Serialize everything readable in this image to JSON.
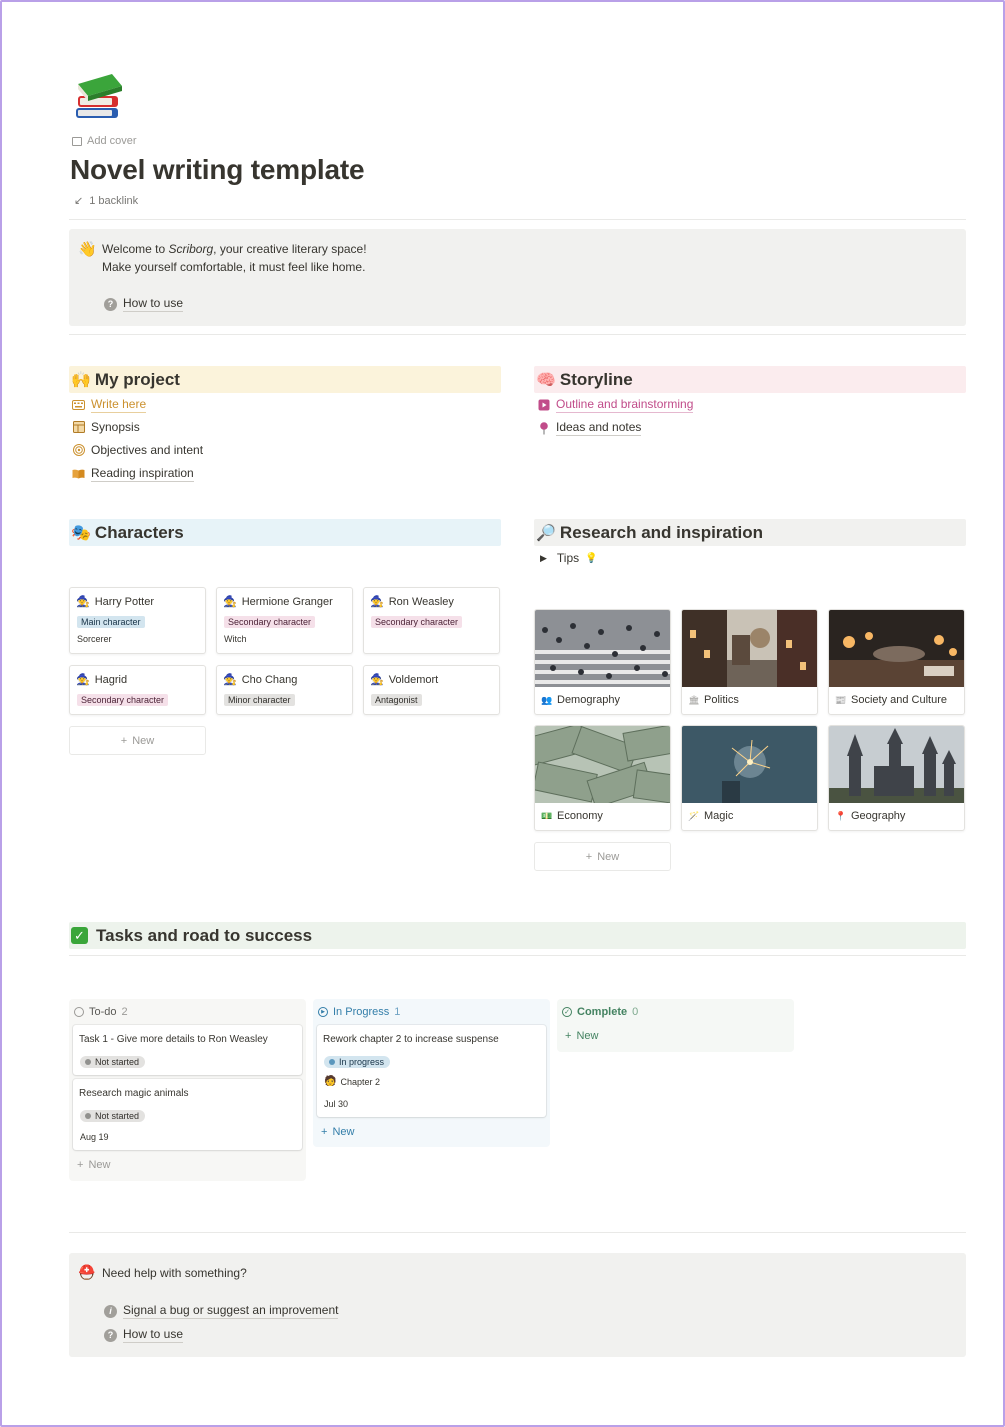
{
  "page": {
    "add_cover": "Add cover",
    "title": "Novel writing template",
    "backlink": "1 backlink"
  },
  "welcome": {
    "line1_pre": "Welcome to ",
    "line1_em": "Scriborg",
    "line1_post": ", your creative literary space!",
    "line2": "Make yourself comfortable, it must feel like home.",
    "how_to_use": "How to use"
  },
  "my_project": {
    "title": "My project",
    "items": [
      {
        "label": "Write here",
        "icon": "keyboard-icon"
      },
      {
        "label": "Synopsis",
        "icon": "layout-icon"
      },
      {
        "label": "Objectives and intent",
        "icon": "target-icon"
      },
      {
        "label": "Reading inspiration",
        "icon": "open-book-icon"
      }
    ]
  },
  "storyline": {
    "title": "Storyline",
    "items": [
      {
        "label": "Outline and brainstorming",
        "icon": "film-icon"
      },
      {
        "label": "Ideas and notes",
        "icon": "pin-icon"
      }
    ]
  },
  "characters": {
    "title": "Characters",
    "cards": [
      {
        "name": "Harry Potter",
        "tag": "Main character",
        "sub": "Sorcerer"
      },
      {
        "name": "Hermione Granger",
        "tag": "Secondary character",
        "sub": "Witch"
      },
      {
        "name": "Ron Weasley",
        "tag": "Secondary character",
        "sub": ""
      },
      {
        "name": "Hagrid",
        "tag": "Secondary character",
        "sub": ""
      },
      {
        "name": "Cho Chang",
        "tag": "Minor character",
        "sub": ""
      },
      {
        "name": "Voldemort",
        "tag": "Antagonist",
        "sub": ""
      }
    ],
    "new_label": "New"
  },
  "research": {
    "title": "Research and inspiration",
    "tips": "Tips",
    "cards": [
      {
        "label": "Demography",
        "icon": "people-icon"
      },
      {
        "label": "Politics",
        "icon": "government-icon"
      },
      {
        "label": "Society and Culture",
        "icon": "newspaper-icon"
      },
      {
        "label": "Economy",
        "icon": "money-icon"
      },
      {
        "label": "Magic",
        "icon": "wand-icon"
      },
      {
        "label": "Geography",
        "icon": "location-icon"
      }
    ],
    "new_label": "New"
  },
  "tasks": {
    "title": "Tasks and road to success",
    "columns": [
      {
        "name": "To-do",
        "count": "2"
      },
      {
        "name": "In Progress",
        "count": "1"
      },
      {
        "name": "Complete",
        "count": "0"
      }
    ],
    "cards": [
      {
        "title": "Task 1 - Give more details to Ron Weasley",
        "status": "Not started"
      },
      {
        "title": "Research magic animals",
        "status": "Not started",
        "date": "Aug 19"
      },
      {
        "title": "Rework chapter 2 to increase suspense",
        "status": "In progress",
        "relation": "Chapter 2",
        "date": "Jul 30"
      }
    ],
    "new_label": "New"
  },
  "help": {
    "title": "Need help with something?",
    "links": [
      "Signal a bug or suggest an improvement",
      "How to use"
    ]
  },
  "colors": {
    "accent_orange": "#cb912f",
    "accent_pink": "#c14c8a",
    "accent_blue": "#337ea9",
    "accent_green": "#448361",
    "frame": "#b9a0e8"
  }
}
